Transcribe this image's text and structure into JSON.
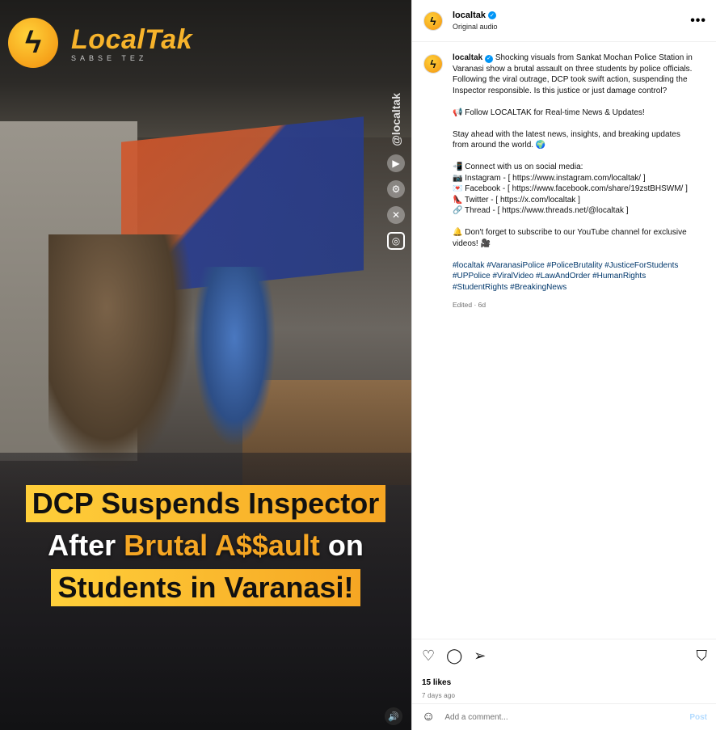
{
  "media": {
    "logo_name": "LocalTak",
    "logo_tagline": "SABSE TEZ",
    "watermark": "@localtak",
    "headline": {
      "line1": "DCP Suspends Inspector",
      "line2_prefix": "After ",
      "line2_accent": "Brutal A$$ault",
      "line2_suffix": " on",
      "line3": "Students in Varanasi!"
    }
  },
  "header": {
    "username": "localtak",
    "subtitle": "Original audio",
    "more": "•••"
  },
  "caption": {
    "username": "localtak",
    "p1": "Shocking visuals from Sankat Mochan Police Station in Varanasi show a brutal assault on three students by police officials. Following the viral outrage, DCP took swift action, suspending the Inspector responsible. Is this justice or just damage control?",
    "p2": "📢 Follow LOCALTAK for Real-time News & Updates!",
    "p3": "Stay ahead with the latest news, insights, and breaking updates from around the world. 🌍",
    "p4": "📲 Connect with us on social media:\n📷 Instagram - [ https://www.instagram.com/localtak/ ]\n💌 Facebook - [ https://www.facebook.com/share/19zstBHSWM/ ]\n👠 Twitter - [ https://x.com/localtak ]\n🔗 Thread - [ https://www.threads.net/@localtak ]",
    "p5": "🔔 Don't forget to subscribe to our YouTube channel for exclusive videos! 🎥",
    "hashtags": "#localtak #VaranasiPolice #PoliceBrutality #JusticeForStudents #UPPolice #ViralVideo #LawAndOrder #HumanRights #StudentRights #BreakingNews",
    "edited": "Edited · 6d"
  },
  "engagement": {
    "likes": "15 likes",
    "time": "7 days ago"
  },
  "comment": {
    "placeholder": "Add a comment...",
    "post": "Post"
  },
  "colors": {
    "accent_yellow": "#f6a623",
    "verified_blue": "#0095f6",
    "hashtag_blue": "#00376b",
    "post_disabled": "#b3dbff"
  },
  "icons": [
    "bolt-icon",
    "verified-icon",
    "more-icon",
    "heart-icon",
    "comment-icon",
    "share-icon",
    "bookmark-icon",
    "emoji-icon",
    "mute-icon",
    "play-icon",
    "gear-icon",
    "x-icon",
    "instagram-icon"
  ]
}
